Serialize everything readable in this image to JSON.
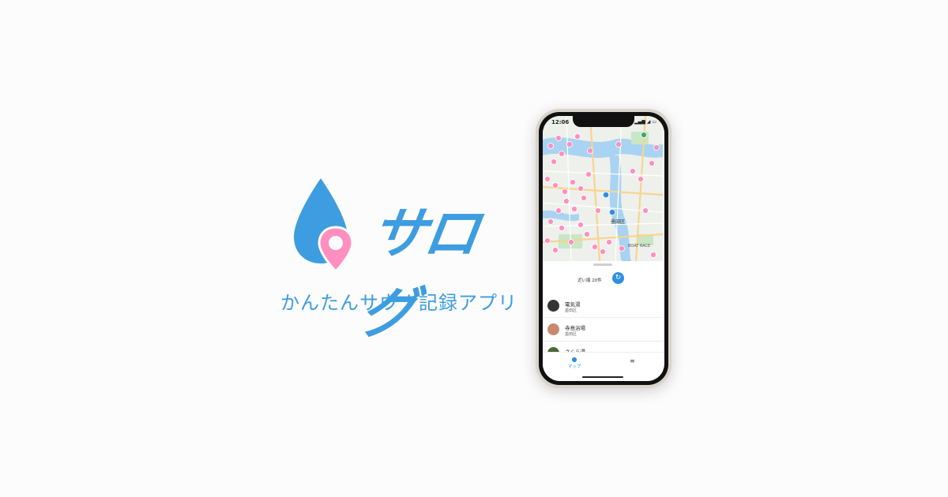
{
  "brand": {
    "logo_text": "サログ",
    "tagline": "かんたんサウナ記録アプリ",
    "primary_color": "#3d9de0",
    "accent_color": "#ff8fbf"
  },
  "phone": {
    "status": {
      "time": "12:06",
      "icons": "▂▄▆ ◢ ▭"
    },
    "map": {
      "labels": [
        "BOAT RACE",
        "墨田区"
      ],
      "pin_color": "#ff8fbf",
      "current_location_color": "#2f8fe0"
    },
    "sheet": {
      "nearby_label": "近い順 20件",
      "refresh_icon": "refresh-icon"
    },
    "list": [
      {
        "name": "電気湯",
        "ward": "墨田区",
        "avatar_color": "#333333"
      },
      {
        "name": "寺島浴場",
        "ward": "墨田区",
        "avatar_color": "#c98a6c"
      },
      {
        "name": "さくら湯",
        "ward": "",
        "avatar_color": "#4a6a3a"
      }
    ],
    "tabbar": {
      "map_label": "マップ",
      "map_icon": "location-pin-icon",
      "list_icon": "list-icon"
    }
  }
}
